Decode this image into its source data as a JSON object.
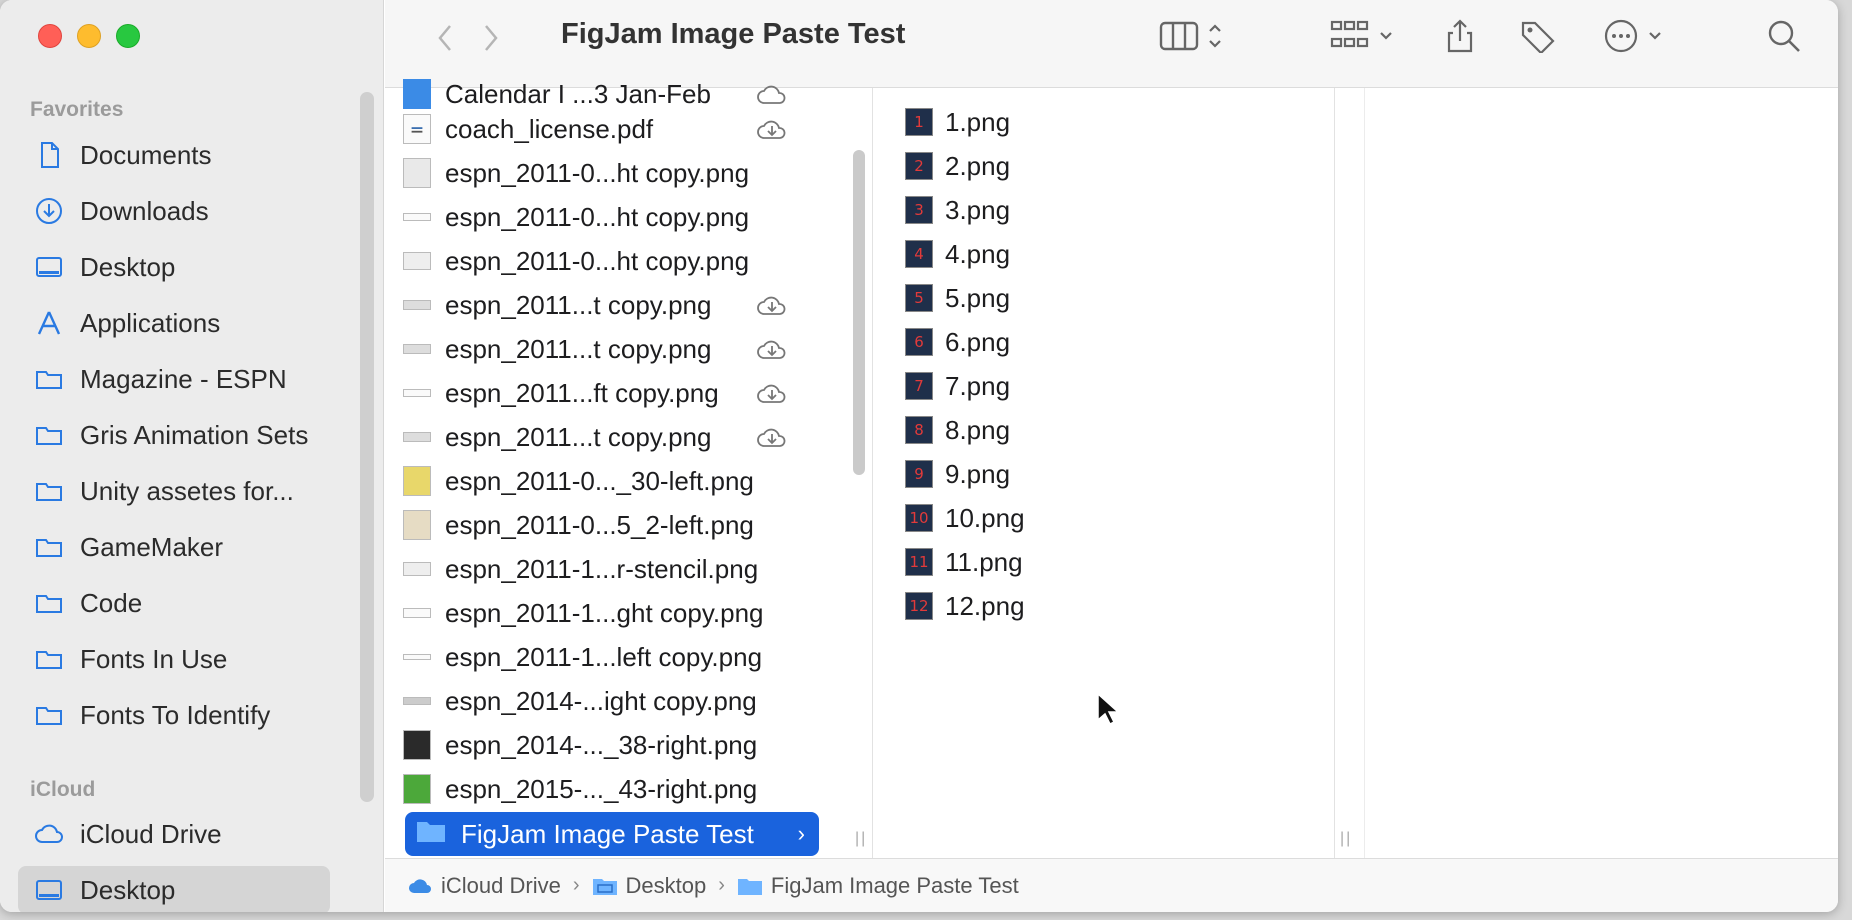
{
  "window": {
    "title": "FigJam Image Paste Test"
  },
  "sidebar": {
    "favorites_header": "Favorites",
    "favorites": [
      {
        "label": "Documents",
        "icon": "document-icon"
      },
      {
        "label": "Downloads",
        "icon": "download-icon"
      },
      {
        "label": "Desktop",
        "icon": "desktop-icon"
      },
      {
        "label": "Applications",
        "icon": "applications-icon"
      },
      {
        "label": "Magazine - ESPN",
        "icon": "folder-icon"
      },
      {
        "label": "Gris Animation Sets",
        "icon": "folder-icon"
      },
      {
        "label": "Unity assetes for...",
        "icon": "folder-icon"
      },
      {
        "label": "GameMaker",
        "icon": "folder-icon"
      },
      {
        "label": "Code",
        "icon": "folder-icon"
      },
      {
        "label": "Fonts In Use",
        "icon": "folder-icon"
      },
      {
        "label": "Fonts To Identify",
        "icon": "folder-icon"
      }
    ],
    "icloud_header": "iCloud",
    "icloud": [
      {
        "label": "iCloud Drive",
        "icon": "cloud-icon"
      },
      {
        "label": "Desktop",
        "icon": "desktop-icon",
        "selected": true
      }
    ]
  },
  "column1": {
    "items": [
      {
        "name": "Calendar I ...3 Jan-Feb",
        "cloud": true
      },
      {
        "name": "coach_license.pdf",
        "cloud": true
      },
      {
        "name": "espn_2011-0...ht copy.png",
        "cloud": false
      },
      {
        "name": "espn_2011-0...ht copy.png",
        "cloud": false
      },
      {
        "name": "espn_2011-0...ht copy.png",
        "cloud": false
      },
      {
        "name": "espn_2011...t copy.png",
        "cloud": true
      },
      {
        "name": "espn_2011...t copy.png",
        "cloud": true
      },
      {
        "name": "espn_2011...ft copy.png",
        "cloud": true
      },
      {
        "name": "espn_2011...t copy.png",
        "cloud": true
      },
      {
        "name": "espn_2011-0..._30-left.png",
        "cloud": false
      },
      {
        "name": "espn_2011-0...5_2-left.png",
        "cloud": false
      },
      {
        "name": "espn_2011-1...r-stencil.png",
        "cloud": false
      },
      {
        "name": "espn_2011-1...ght copy.png",
        "cloud": false
      },
      {
        "name": "espn_2011-1...left copy.png",
        "cloud": false
      },
      {
        "name": "espn_2014-...ight copy.png",
        "cloud": false
      },
      {
        "name": "espn_2014-..._38-right.png",
        "cloud": false
      },
      {
        "name": "espn_2015-..._43-right.png",
        "cloud": false
      }
    ],
    "selected": {
      "name": "FigJam Image Paste Test",
      "chevron": "›"
    }
  },
  "column2": {
    "items": [
      {
        "name": "1.png",
        "n": "1"
      },
      {
        "name": "2.png",
        "n": "2"
      },
      {
        "name": "3.png",
        "n": "3"
      },
      {
        "name": "4.png",
        "n": "4"
      },
      {
        "name": "5.png",
        "n": "5"
      },
      {
        "name": "6.png",
        "n": "6"
      },
      {
        "name": "7.png",
        "n": "7"
      },
      {
        "name": "8.png",
        "n": "8"
      },
      {
        "name": "9.png",
        "n": "9"
      },
      {
        "name": "10.png",
        "n": "10"
      },
      {
        "name": "11.png",
        "n": "11"
      },
      {
        "name": "12.png",
        "n": "12"
      }
    ]
  },
  "pathbar": {
    "crumbs": [
      "iCloud Drive",
      "Desktop",
      "FigJam Image Paste Test"
    ],
    "separator": "›"
  },
  "colors": {
    "selection": "#1a63dd",
    "sidebar_icon": "#2a7ae2"
  }
}
